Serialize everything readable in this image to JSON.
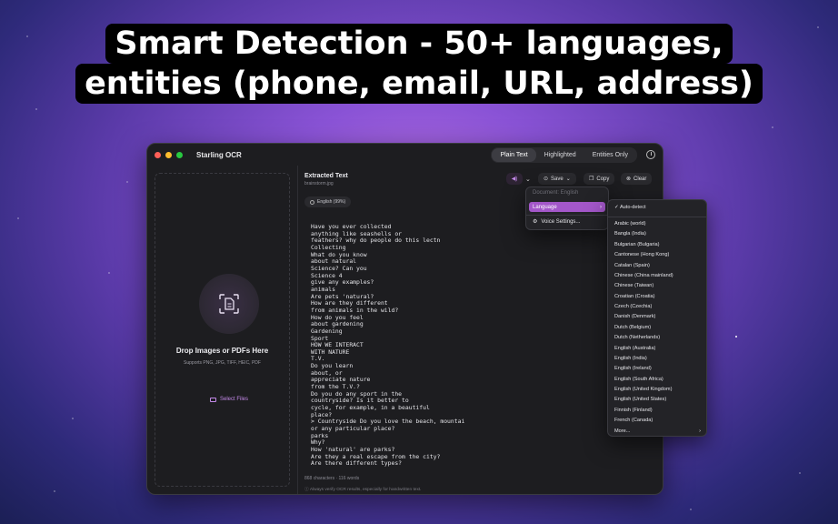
{
  "headline": {
    "line1": "Smart Detection - 50+ languages,",
    "line2": "entities (phone, email, URL, address)"
  },
  "window": {
    "app_title": "Starling OCR",
    "view_modes": [
      "Plain Text",
      "Highlighted",
      "Entities Only"
    ],
    "active_view": "Plain Text",
    "history_icon": "clock-icon"
  },
  "drop_zone": {
    "icon": "document-scan-icon",
    "title": "Drop Images or PDFs Here",
    "subtitle": "Supports PNG, JPG, TIFF, HEIC, PDF",
    "select_label": "Select Files"
  },
  "result": {
    "title": "Extracted Text",
    "filename": "brainstorm.jpg",
    "toolbar": {
      "save": "Save",
      "copy": "Copy",
      "clear": "Clear"
    },
    "language_chip": "English (99%)",
    "text_lines": [
      "Have you ever collected",
      "anything like seashells or",
      "feathers? why do people do this lectn",
      "Collecting",
      "What do you know",
      "about natural",
      "Science? Can you",
      "Science 4",
      "give any examples?",
      "animals",
      "Are pets 'natural?",
      "How are they different",
      "from animals in the wild?",
      "How do you feel",
      "about gardening",
      "Gardening",
      "Sport",
      "HOW WE INTERACT",
      "WITH NATURE",
      "T.V.",
      "Do you learn",
      "about, or",
      "appreciate nature",
      "from the T.V.?",
      "Do you do any sport in the",
      "countryside? Is it better to",
      "cycle, for example, in a beautiful",
      "place?",
      "> Countryside Do you love the beach, mountai",
      "or any particular place?",
      "parks",
      "Why?",
      "How 'natural' are parks?",
      "Are they a real escape from the city?",
      "Are there different types?"
    ],
    "stats": "868 characters  ·  116 words",
    "note": "Always verify OCR results, especially for handwritten text."
  },
  "save_menu": {
    "header": "Document: English",
    "language_item": "Language",
    "voice_item": "Voice Settings..."
  },
  "language_menu": {
    "checked": "Auto-detect",
    "items": [
      "Arabic (world)",
      "Bangla (India)",
      "Bulgarian (Bulgaria)",
      "Cantonese (Hong Kong)",
      "Catalan (Spain)",
      "Chinese (China mainland)",
      "Chinese (Taiwan)",
      "Croatian (Croatia)",
      "Czech (Czechia)",
      "Danish (Denmark)",
      "Dutch (Belgium)",
      "Dutch (Netherlands)",
      "English (Australia)",
      "English (India)",
      "English (Ireland)",
      "English (South Africa)",
      "English (United Kingdom)",
      "English (United States)",
      "Finnish (Finland)",
      "French (Canada)"
    ],
    "more": "More..."
  }
}
